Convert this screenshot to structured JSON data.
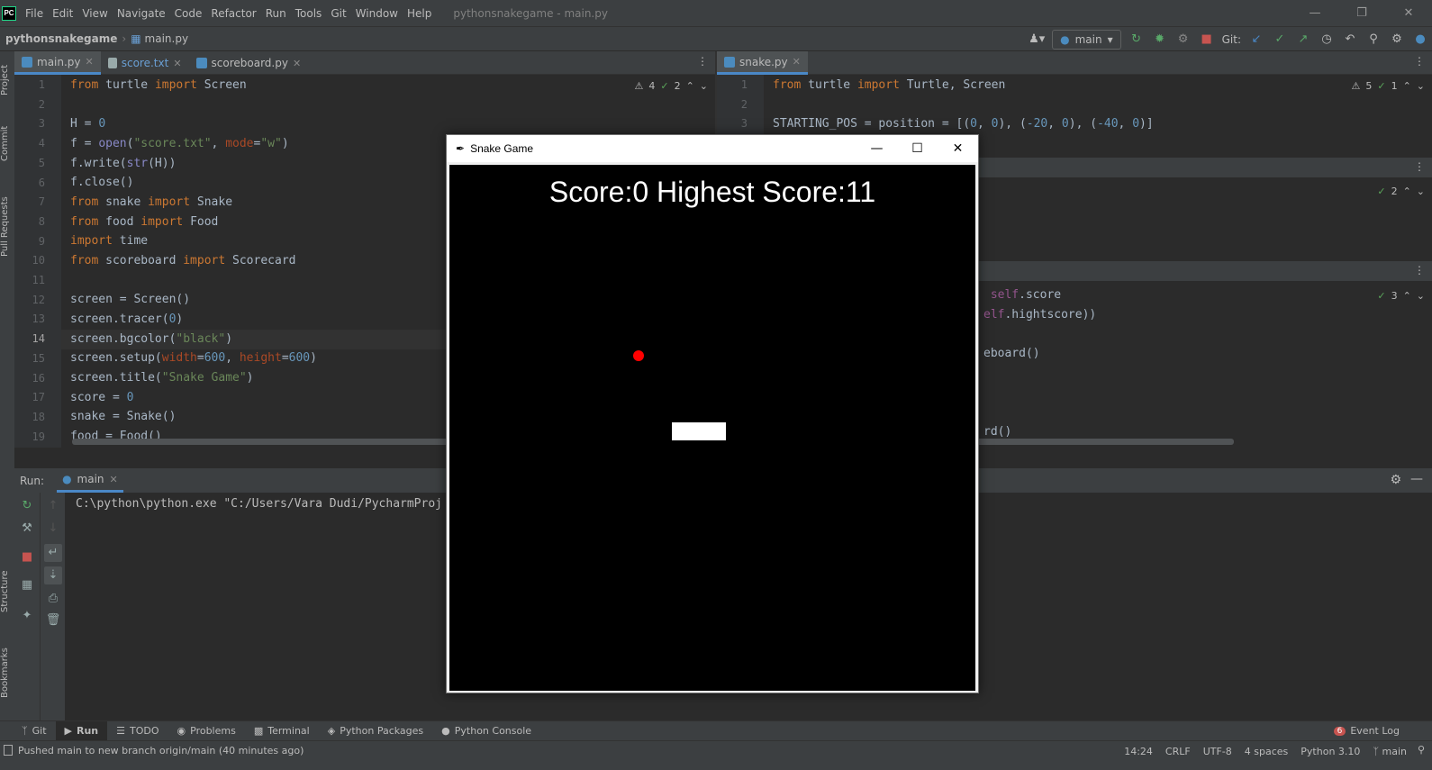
{
  "app": {
    "logo_text": "PC",
    "menu": [
      "File",
      "Edit",
      "View",
      "Navigate",
      "Code",
      "Refactor",
      "Run",
      "Tools",
      "Git",
      "Window",
      "Help"
    ],
    "window_title": "pythonsnakegame - main.py"
  },
  "navbar": {
    "project": "pythonsnakegame",
    "file": "main.py",
    "branch": "main",
    "git_label": "Git:"
  },
  "side_tabs": [
    "Project",
    "Commit",
    "Pull Requests",
    "Structure",
    "Bookmarks"
  ],
  "left_editor": {
    "tabs": [
      {
        "label": "main.py",
        "active": true
      },
      {
        "label": "score.txt",
        "active": false
      },
      {
        "label": "scoreboard.py",
        "active": false
      }
    ],
    "warnings": "4",
    "ok": "2",
    "line_numbers": [
      "1",
      "2",
      "3",
      "4",
      "5",
      "6",
      "7",
      "8",
      "9",
      "10",
      "11",
      "12",
      "13",
      "14",
      "15",
      "16",
      "17",
      "18",
      "19"
    ],
    "current_line": "14"
  },
  "right_editor": {
    "tabs": [
      {
        "label": "snake.py",
        "active": true
      }
    ],
    "warnings": "5",
    "ok1": "1",
    "ok2": "2",
    "ok3": "3",
    "line_numbers": [
      "1",
      "2",
      "3"
    ]
  },
  "run_panel": {
    "title": "Run:",
    "tab": "main",
    "console_line": "C:\\python\\python.exe \"C:/Users/Vara Dudi/PycharmProj"
  },
  "bottom_tabs": [
    "Git",
    "Run",
    "TODO",
    "Problems",
    "Terminal",
    "Python Packages",
    "Python Console"
  ],
  "event_log": {
    "label": "Event Log",
    "count": "6"
  },
  "status": {
    "message": "Pushed main to new branch origin/main (40 minutes ago)",
    "position": "14:24",
    "line_sep": "CRLF",
    "encoding": "UTF-8",
    "indent": "4 spaces",
    "interpreter": "Python 3.10",
    "branch": "main"
  },
  "snake_window": {
    "title": "Snake Game",
    "score_text": "Score:0 Highest Score:11"
  },
  "colors": {
    "accent": "#4a88c7",
    "ide_bg": "#2b2b2b",
    "panel": "#3c3f41",
    "food": "#ff0000"
  }
}
